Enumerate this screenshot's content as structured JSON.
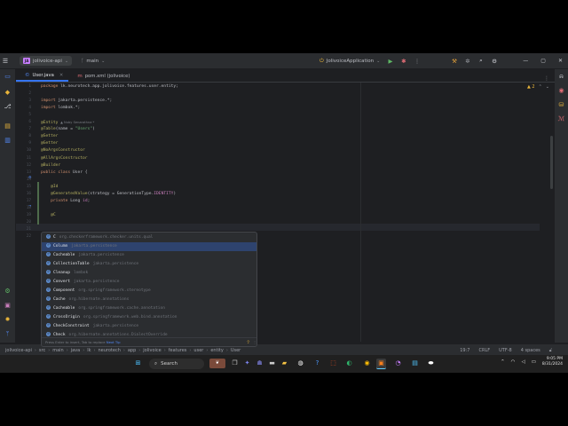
{
  "titlebar": {
    "project_badge": "JA",
    "project": "jolivoice-api",
    "branch": "main",
    "run_config": "JolivoiceApplication",
    "icons": [
      "hamburger-menu-icon",
      "run-icon",
      "debug-icon",
      "more-icon",
      "hammer-icon",
      "settings-icon",
      "search-icon",
      "gear-icon",
      "minimize-icon",
      "restore-icon",
      "close-icon"
    ]
  },
  "tabs": [
    {
      "label": "User.java",
      "icon": "java-class-icon",
      "active": true
    },
    {
      "label": "pom.xml (jolivoice)",
      "icon": "maven-icon",
      "active": false
    }
  ],
  "editor": {
    "warnings": "▲ 2",
    "lines": [
      {
        "num": "1",
        "html": "<span class='kw'>package</span> lk.neurotech.app.jolivoice.features.user.entity;"
      },
      {
        "num": "2",
        "html": ""
      },
      {
        "num": "3",
        "html": "<span class='kw'>import</span> jakarta.persistence.*;"
      },
      {
        "num": "4",
        "html": "<span class='kw'>import</span> lombok.*;"
      },
      {
        "num": "5",
        "html": ""
      },
      {
        "num": "6",
        "html": "<span class='an'>@Entity</span> <span class='hint'>▲ Nuby Senarathna *</span>"
      },
      {
        "num": "7",
        "html": "<span class='an'>@Table</span>(name = <span class='st'>\"Users\"</span>)"
      },
      {
        "num": "8",
        "html": "<span class='an'>@Setter</span>"
      },
      {
        "num": "9",
        "html": "<span class='an'>@Getter</span>"
      },
      {
        "num": "10",
        "html": "<span class='an'>@NoArgsConstructor</span>"
      },
      {
        "num": "11",
        "html": "<span class='an'>@AllArgsConstructor</span>"
      },
      {
        "num": "12",
        "html": "<span class='an'>@Builder</span>"
      },
      {
        "num": "13",
        "html": "<span class='kw'>public class</span> User {"
      },
      {
        "num": "14",
        "html": ""
      },
      {
        "num": "15",
        "html": "    <span class='an'>@Id</span>"
      },
      {
        "num": "16",
        "html": "    <span class='an'>@GeneratedValue</span>(strategy = GenerationType.<span class='fd'>IDENTITY</span>)"
      },
      {
        "num": "17",
        "html": "    <span class='kw'>private</span> Long <span class='fd'>id</span>;"
      },
      {
        "num": "18",
        "html": ""
      },
      {
        "num": "19",
        "html": "    <span class='an'>@C</span>"
      },
      {
        "num": "20",
        "html": ""
      },
      {
        "num": "21",
        "html": ""
      },
      {
        "num": "22",
        "html": ""
      }
    ]
  },
  "completion": {
    "items": [
      {
        "name": "C",
        "pkg": "org.checkerframework.checker.units.qual",
        "selected": false
      },
      {
        "name": "Column",
        "pkg": "jakarta.persistence",
        "selected": true
      },
      {
        "name": "Cacheable",
        "pkg": "jakarta.persistence",
        "selected": false
      },
      {
        "name": "CollectionTable",
        "pkg": "jakarta.persistence",
        "selected": false
      },
      {
        "name": "Cleanup",
        "pkg": "lombok",
        "selected": false
      },
      {
        "name": "Convert",
        "pkg": "jakarta.persistence",
        "selected": false
      },
      {
        "name": "Component",
        "pkg": "org.springframework.stereotype",
        "selected": false
      },
      {
        "name": "Cache",
        "pkg": "org.hibernate.annotations",
        "selected": false
      },
      {
        "name": "Cacheable",
        "pkg": "org.springframework.cache.annotation",
        "selected": false
      },
      {
        "name": "CrossOrigin",
        "pkg": "org.springframework.web.bind.annotation",
        "selected": false
      },
      {
        "name": "CheckConstraint",
        "pkg": "jakarta.persistence",
        "selected": false
      },
      {
        "name": "Check",
        "pkg": "org.hibernate.annotations.DialectOverride",
        "selected": false
      }
    ],
    "footer_text": "Press Enter to insert, Tab to replace",
    "footer_link": "Next Tip"
  },
  "statusbar": {
    "crumbs": [
      "jolivoice-api",
      "src",
      "main",
      "java",
      "lk",
      "neurotech",
      "app",
      "jolivoice",
      "features",
      "user",
      "entity",
      "User"
    ],
    "position": "19:7",
    "line_sep": "CRLF",
    "encoding": "UTF-8",
    "indent": "4 spaces"
  },
  "taskbar": {
    "search": "Search",
    "time": "9:05 PM",
    "date": "8/31/2024"
  }
}
